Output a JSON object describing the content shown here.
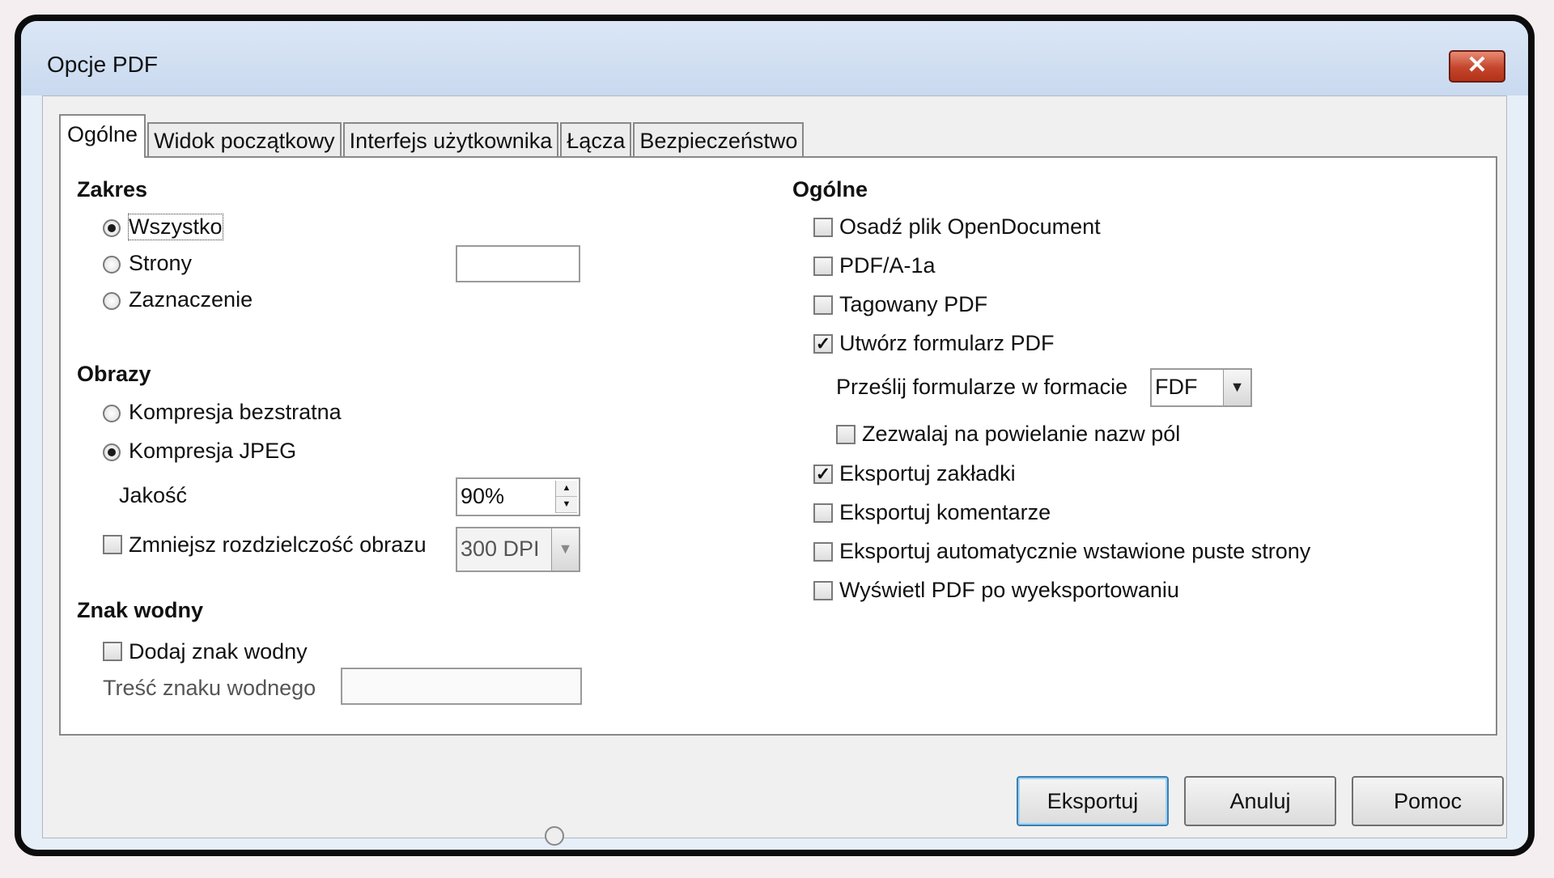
{
  "window": {
    "title": "Opcje PDF",
    "close_symbol": "✕"
  },
  "tabs": [
    {
      "label": "Ogólne",
      "active": true
    },
    {
      "label": "Widok początkowy",
      "active": false
    },
    {
      "label": "Interfejs użytkownika",
      "active": false
    },
    {
      "label": "Łącza",
      "active": false
    },
    {
      "label": "Bezpieczeństwo",
      "active": false
    }
  ],
  "left": {
    "range": {
      "heading": "Zakres",
      "all_label": "Wszystko",
      "pages_label": "Strony",
      "pages_value": "",
      "selection_label": "Zaznaczenie",
      "selected": "all"
    },
    "images": {
      "heading": "Obrazy",
      "lossless_label": "Kompresja bezstratna",
      "jpeg_label": "Kompresja JPEG",
      "selected": "jpeg",
      "quality_label": "Jakość",
      "quality_value": "90%",
      "reduce_label": "Zmniejsz rozdzielczość obrazu",
      "reduce_checked": false,
      "dpi_value": "300 DPI"
    },
    "watermark": {
      "heading": "Znak wodny",
      "add_label": "Dodaj znak wodny",
      "add_checked": false,
      "text_label": "Treść znaku wodnego",
      "text_value": ""
    }
  },
  "right": {
    "heading": "Ogólne",
    "options": [
      {
        "label": "Osadź plik OpenDocument",
        "checked": false
      },
      {
        "label": "PDF/A-1a",
        "checked": false
      },
      {
        "label": "Tagowany PDF",
        "checked": false
      },
      {
        "label": "Utwórz formularz PDF",
        "checked": true
      }
    ],
    "submit_format_label": "Prześlij formularze w formacie",
    "submit_format_value": "FDF",
    "allow_duplicates_label": "Zezwalaj na powielanie nazw pól",
    "allow_duplicates_checked": false,
    "more_options": [
      {
        "label": "Eksportuj zakładki",
        "checked": true
      },
      {
        "label": "Eksportuj komentarze",
        "checked": false
      },
      {
        "label": "Eksportuj automatycznie wstawione puste strony",
        "checked": false
      },
      {
        "label": "Wyświetl PDF po wyeksportowaniu",
        "checked": false
      }
    ],
    "check_mark": "✓"
  },
  "buttons": {
    "export": "Eksportuj",
    "cancel": "Anuluj",
    "help": "Pomoc"
  },
  "icons": {
    "spin_up": "▲",
    "spin_down": "▼",
    "dropdown": "▼"
  }
}
